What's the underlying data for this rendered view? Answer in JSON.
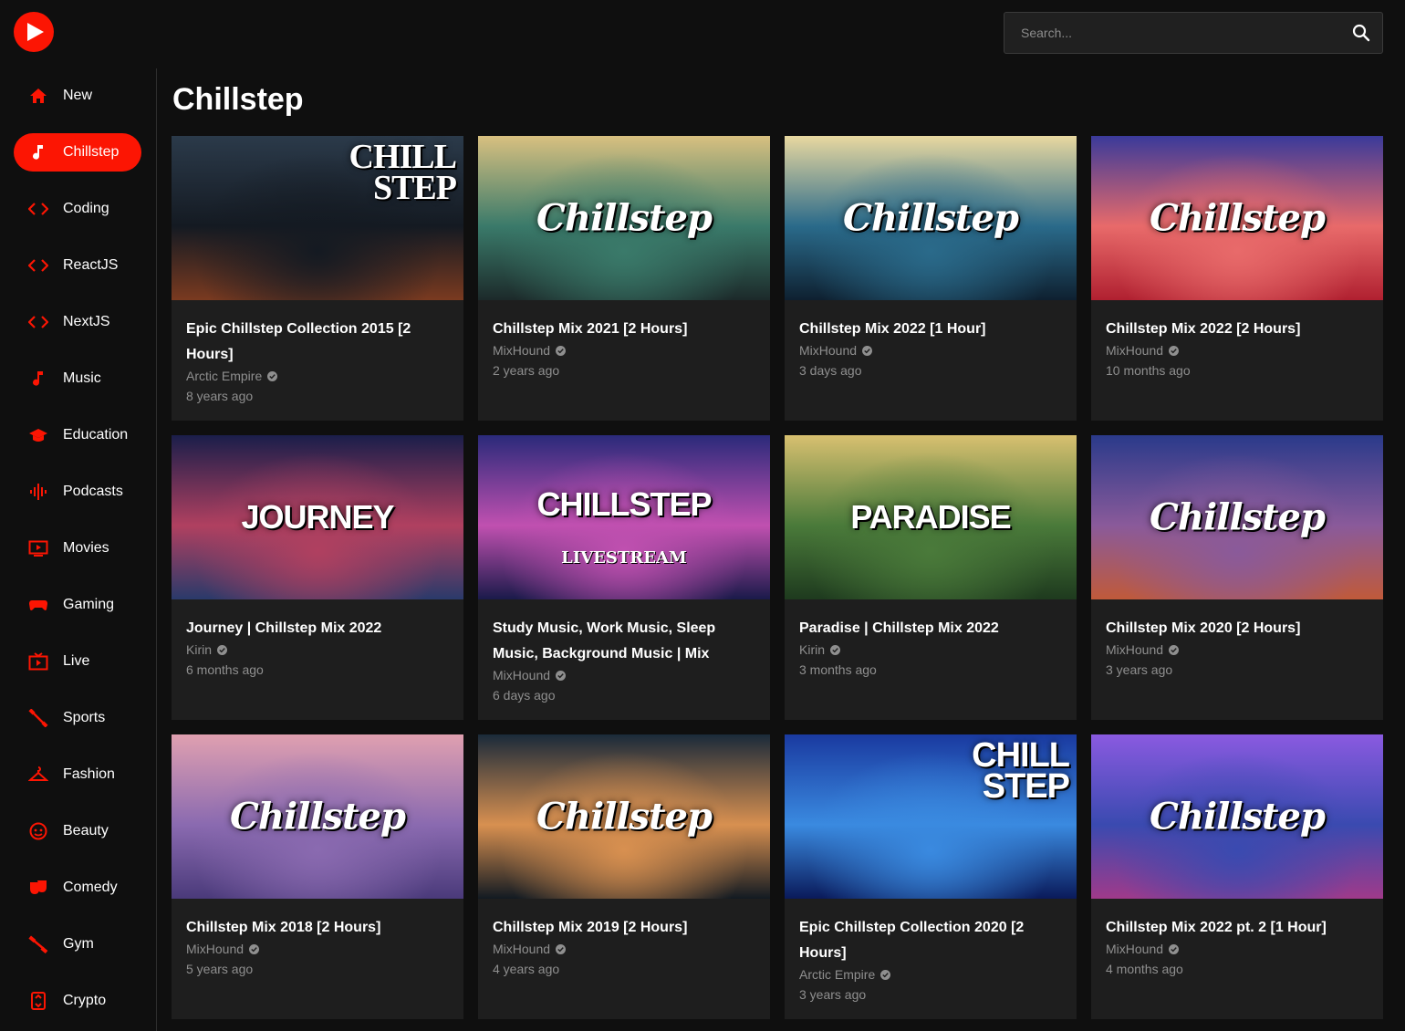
{
  "brand": {
    "accent": "#fc1503"
  },
  "search": {
    "placeholder": "Search..."
  },
  "sidebar": {
    "items": [
      {
        "label": "New",
        "icon": "home-icon"
      },
      {
        "label": "Chillstep",
        "icon": "music-note-icon",
        "active": true
      },
      {
        "label": "Coding",
        "icon": "code-icon"
      },
      {
        "label": "ReactJS",
        "icon": "code-icon"
      },
      {
        "label": "NextJS",
        "icon": "code-icon"
      },
      {
        "label": "Music",
        "icon": "music-note-icon"
      },
      {
        "label": "Education",
        "icon": "graduation-cap-icon"
      },
      {
        "label": "Podcasts",
        "icon": "soundwave-icon"
      },
      {
        "label": "Movies",
        "icon": "tv-icon"
      },
      {
        "label": "Gaming",
        "icon": "gamepad-icon"
      },
      {
        "label": "Live",
        "icon": "live-tv-icon"
      },
      {
        "label": "Sports",
        "icon": "fitness-icon"
      },
      {
        "label": "Fashion",
        "icon": "hanger-icon"
      },
      {
        "label": "Beauty",
        "icon": "face-icon"
      },
      {
        "label": "Comedy",
        "icon": "theater-masks-icon"
      },
      {
        "label": "Gym",
        "icon": "dumbbell-icon"
      },
      {
        "label": "Crypto",
        "icon": "crypto-icon"
      }
    ]
  },
  "main": {
    "title": "Chillstep",
    "videos": [
      {
        "title": "Epic Chillstep Collection 2015 [2 Hours]",
        "channel": "Arctic Empire",
        "age": "8 years ago",
        "thumb_text": "CHILL STEP",
        "thumb_style": "corner",
        "colors": [
          "#2b3a4a",
          "#141a22",
          "#7a3a20"
        ]
      },
      {
        "title": "Chillstep Mix 2021 [2 Hours]",
        "channel": "MixHound",
        "age": "2 years ago",
        "thumb_text": "Chillstep",
        "thumb_style": "script",
        "colors": [
          "#d8c080",
          "#3a7a6a",
          "#1c2a2a"
        ]
      },
      {
        "title": "Chillstep Mix 2022 [1 Hour]",
        "channel": "MixHound",
        "age": "3 days ago",
        "thumb_text": "Chillstep",
        "thumb_style": "script",
        "colors": [
          "#e8d8a0",
          "#2a6a8a",
          "#0e2030"
        ]
      },
      {
        "title": "Chillstep Mix 2022 [2 Hours]",
        "channel": "MixHound",
        "age": "10 months ago",
        "thumb_text": "Chillstep",
        "thumb_style": "script",
        "colors": [
          "#3a3a9a",
          "#e86a6a",
          "#b02030"
        ]
      },
      {
        "title": "Journey | Chillstep Mix 2022",
        "channel": "Kirin",
        "age": "6 months ago",
        "thumb_text": "JOURNEY",
        "thumb_style": "block",
        "colors": [
          "#1a1e4a",
          "#b04060",
          "#2a3a6a"
        ]
      },
      {
        "title": "Study Music, Work Music, Sleep Music, Background Music | Mix",
        "channel": "MixHound",
        "age": "6 days ago",
        "thumb_text": "CHILLSTEP",
        "thumb_sub": "LIVESTREAM",
        "thumb_style": "block",
        "colors": [
          "#2a2a7a",
          "#c050b0",
          "#1a1a4a"
        ]
      },
      {
        "title": "Paradise | Chillstep Mix 2022",
        "channel": "Kirin",
        "age": "3 months ago",
        "thumb_text": "PARADISE",
        "thumb_style": "block",
        "colors": [
          "#d8c070",
          "#4a7a3a",
          "#1e3a1e"
        ]
      },
      {
        "title": "Chillstep Mix 2020 [2 Hours]",
        "channel": "MixHound",
        "age": "3 years ago",
        "thumb_text": "Chillstep",
        "thumb_style": "script",
        "colors": [
          "#2a3a8a",
          "#8a5a9a",
          "#c05a3a"
        ]
      },
      {
        "title": "Chillstep Mix 2018 [2 Hours]",
        "channel": "MixHound",
        "age": "5 years ago",
        "thumb_text": "Chillstep",
        "thumb_style": "script",
        "colors": [
          "#e0a0b0",
          "#8a6ab0",
          "#4a3a7a"
        ]
      },
      {
        "title": "Chillstep Mix 2019 [2 Hours]",
        "channel": "MixHound",
        "age": "4 years ago",
        "thumb_text": "Chillstep",
        "thumb_style": "script",
        "colors": [
          "#1a2a3a",
          "#d89050",
          "#121a22"
        ]
      },
      {
        "title": "Epic Chillstep Collection 2020 [2 Hours]",
        "channel": "Arctic Empire",
        "age": "3 years ago",
        "thumb_text": "CHILL STEP",
        "thumb_style": "corner-sans",
        "colors": [
          "#1a3aa0",
          "#3a8ae0",
          "#0a1a5a"
        ]
      },
      {
        "title": "Chillstep Mix 2022 pt. 2 [1 Hour]",
        "channel": "MixHound",
        "age": "4 months ago",
        "thumb_text": "Chillstep",
        "thumb_style": "script",
        "colors": [
          "#8a5ae0",
          "#3a4ab0",
          "#a03a8a"
        ]
      }
    ]
  }
}
